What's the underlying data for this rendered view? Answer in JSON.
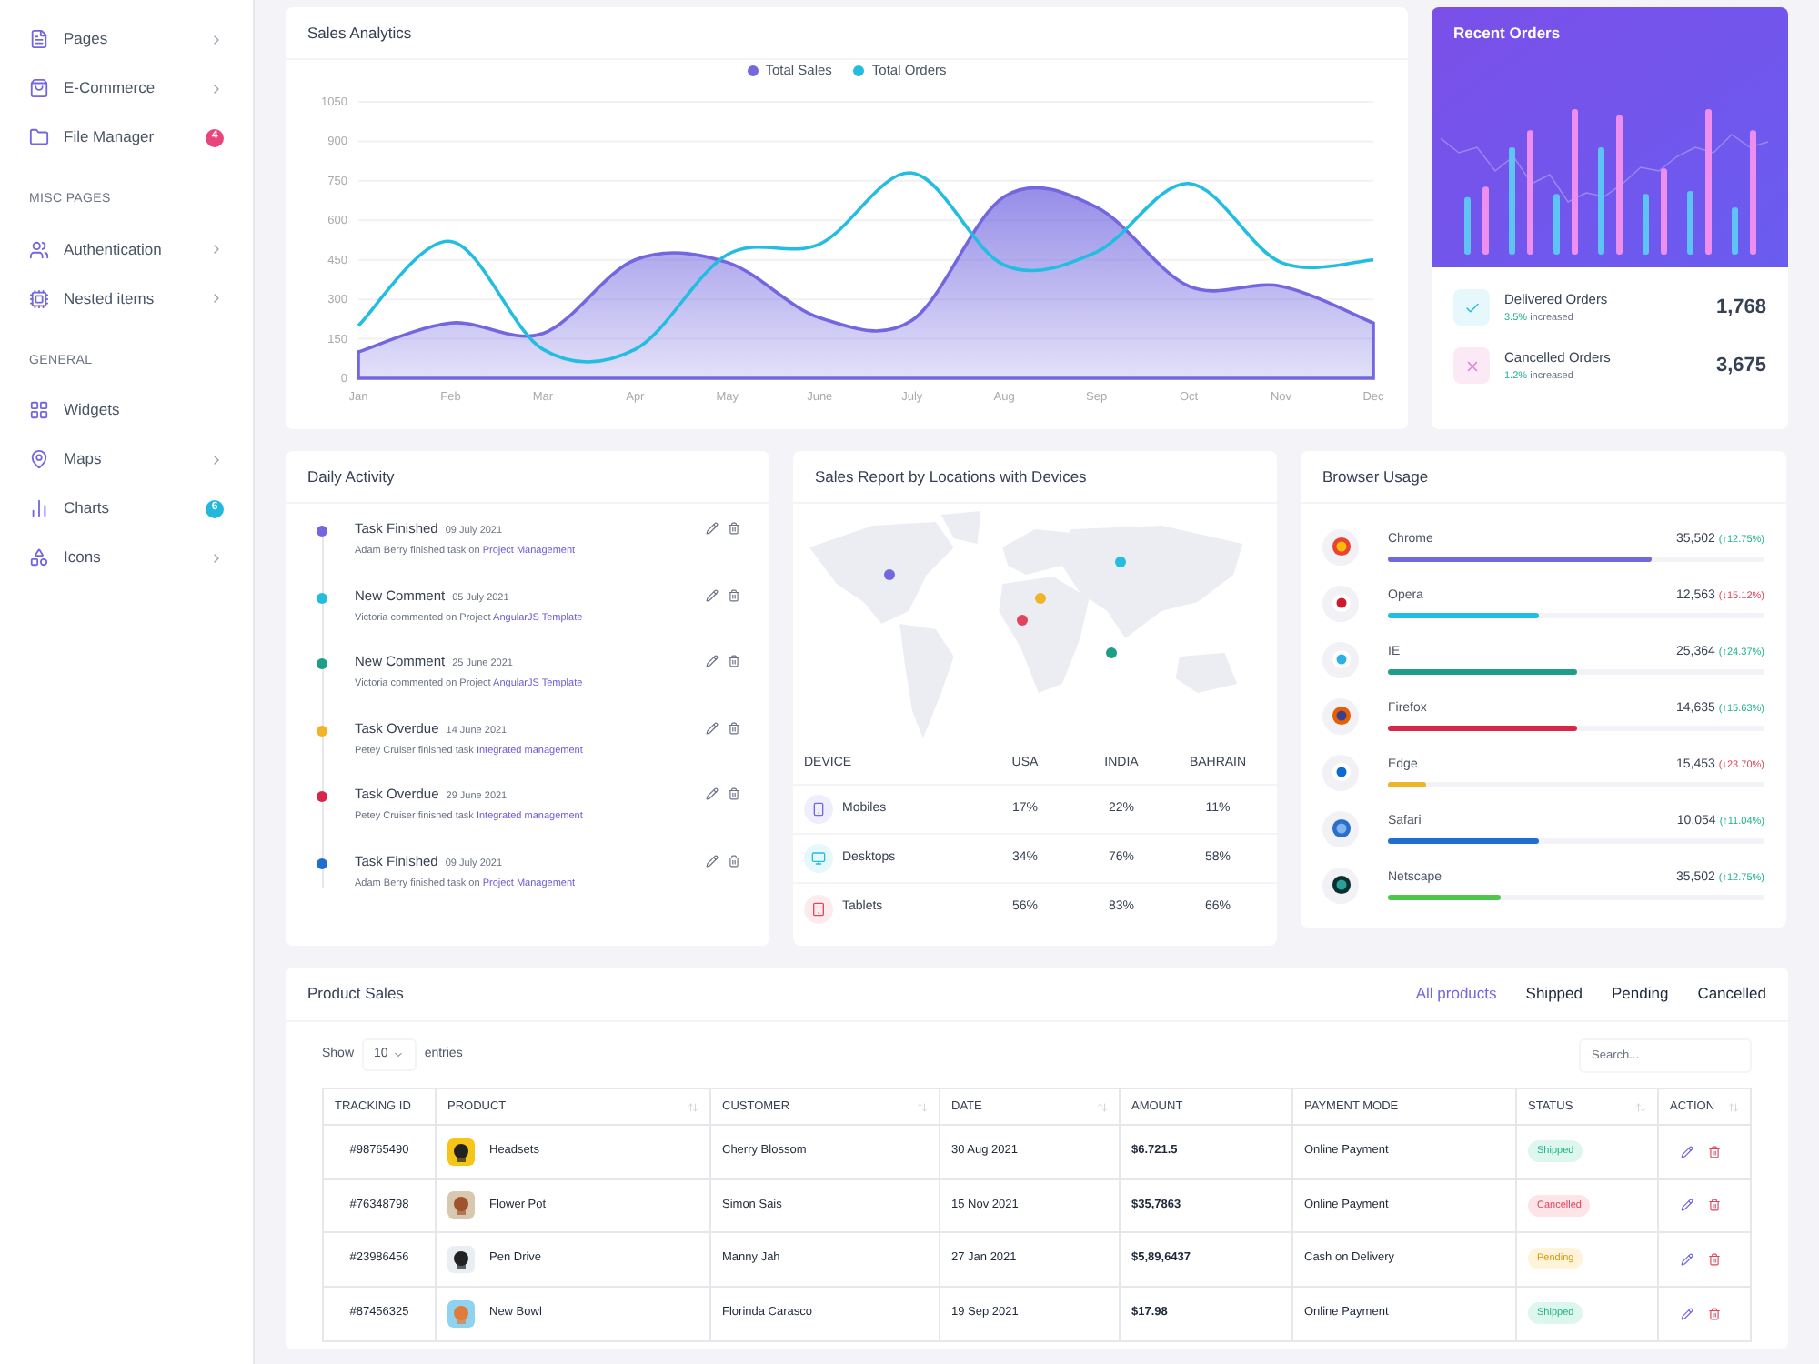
{
  "sidebar": {
    "items": [
      {
        "label": "Pages",
        "chevron": true
      },
      {
        "label": "E-Commerce",
        "chevron": true
      },
      {
        "label": "File Manager",
        "badge": "4",
        "color": "#e8457c"
      },
      {
        "section": "MISC PAGES"
      },
      {
        "label": "Authentication",
        "chevron": true
      },
      {
        "label": "Nested items",
        "chevron": true
      },
      {
        "section": "GENERAL"
      },
      {
        "label": "Widgets"
      },
      {
        "label": "Maps",
        "chevron": true
      },
      {
        "label": "Charts",
        "badge": "6",
        "color": "#22b8dc"
      },
      {
        "label": "Icons",
        "chevron": true
      }
    ]
  },
  "sales_analytics": {
    "title": "Sales Analytics",
    "chart_data": {
      "type": "area",
      "categories": [
        "Jan",
        "Feb",
        "Mar",
        "Apr",
        "May",
        "June",
        "July",
        "Aug",
        "Sep",
        "Oct",
        "Nov",
        "Dec"
      ],
      "ylim": [
        0,
        1050
      ],
      "grid": true,
      "yticks": [
        0,
        150,
        300,
        450,
        600,
        750,
        900,
        1050
      ],
      "series": [
        {
          "name": "Total Sales",
          "type": "area",
          "color": "#7367e0",
          "values": [
            100,
            210,
            170,
            450,
            440,
            230,
            220,
            690,
            650,
            350,
            350,
            210
          ]
        },
        {
          "name": "Total Orders",
          "type": "line",
          "color": "#22bde0",
          "values": [
            200,
            520,
            110,
            110,
            470,
            510,
            780,
            430,
            480,
            740,
            440,
            450
          ]
        }
      ]
    }
  },
  "recent_orders": {
    "title": "Recent Orders",
    "stats": [
      {
        "kind": "delivered",
        "label": "Delivered Orders",
        "change": "3.5%",
        "note": "increased",
        "value": "1,768"
      },
      {
        "kind": "cancelled",
        "label": "Cancelled Orders",
        "change": "1.2%",
        "note": "increased",
        "value": "3,675"
      }
    ]
  },
  "daily_activity": {
    "title": "Daily Activity",
    "items": [
      {
        "color": "#7367e0",
        "title": "Task Finished",
        "date": "09 July 2021",
        "text": "Adam Berry finished task on",
        "link": "Project Management"
      },
      {
        "color": "#22bde0",
        "title": "New Comment",
        "date": "05 July 2021",
        "text": "Victoria commented on Project",
        "link": "AngularJS Template"
      },
      {
        "color": "#1e9e86",
        "title": "New Comment",
        "date": "25 June 2021",
        "text": "Victoria commented on Project",
        "link": "AngularJS Template"
      },
      {
        "color": "#f0b429",
        "title": "Task Overdue",
        "date": "14 June 2021",
        "text": "Petey Cruiser finished task",
        "link": "Integrated management"
      },
      {
        "color": "#d6264a",
        "title": "Task Overdue",
        "date": "29 June 2021",
        "text": "Petey Cruiser finished task",
        "link": "Integrated management"
      },
      {
        "color": "#1f6fd1",
        "title": "Task Finished",
        "date": "09 July 2021",
        "text": "Adam Berry finished task on",
        "link": "Project Management"
      }
    ]
  },
  "sales_report": {
    "title": "Sales Report by Locations with Devices",
    "markers": [
      {
        "color": "#7367e0"
      },
      {
        "color": "#f0b429"
      },
      {
        "color": "#e0455a"
      },
      {
        "color": "#22bde0"
      },
      {
        "color": "#1e9e86"
      }
    ],
    "columns": [
      "DEVICE",
      "USA",
      "INDIA",
      "BAHRAIN"
    ],
    "rows": [
      {
        "kind": "mobile",
        "device": "Mobiles",
        "values": [
          "17%",
          "22%",
          "11%"
        ]
      },
      {
        "kind": "desktop",
        "device": "Desktops",
        "values": [
          "34%",
          "76%",
          "58%"
        ]
      },
      {
        "kind": "tablet",
        "device": "Tablets",
        "values": [
          "56%",
          "83%",
          "66%"
        ]
      }
    ]
  },
  "browser_usage": {
    "title": "Browser Usage",
    "items": [
      {
        "name": "Chrome",
        "value": "35,502",
        "change": "(↑12.75%)",
        "rising": true,
        "level": 0.7,
        "color": "#7367e0"
      },
      {
        "name": "Opera",
        "value": "12,563",
        "change": "(↓15.12%)",
        "rising": false,
        "level": 0.4,
        "color": "#22bde0"
      },
      {
        "name": "IE",
        "value": "25,364",
        "change": "(↑24.37%)",
        "rising": true,
        "level": 0.5,
        "color": "#1e9e86"
      },
      {
        "name": "Firefox",
        "value": "14,635",
        "change": "(↑15.63%)",
        "rising": true,
        "level": 0.5,
        "color": "#d6264a"
      },
      {
        "name": "Edge",
        "value": "15,453",
        "change": "(↓23.70%)",
        "rising": false,
        "level": 0.1,
        "color": "#f0b429"
      },
      {
        "name": "Safari",
        "value": "10,054",
        "change": "(↑11.04%)",
        "rising": true,
        "level": 0.4,
        "color": "#1f6fd1"
      },
      {
        "name": "Netscape",
        "value": "35,502",
        "change": "(↑12.75%)",
        "rising": true,
        "level": 0.3,
        "color": "#4cc74c"
      }
    ]
  },
  "product_sales": {
    "title": "Product Sales",
    "tabs": [
      {
        "label": "All products",
        "selected": true
      },
      {
        "label": "Shipped",
        "selected": false
      },
      {
        "label": "Pending",
        "selected": false
      },
      {
        "label": "Cancelled",
        "selected": false
      }
    ],
    "show_label": "Show",
    "page_size": "10",
    "entries_label": "entries",
    "search": {
      "placeholder": "Search..."
    },
    "columns": [
      {
        "label": "TRACKING ID",
        "sortable": false
      },
      {
        "label": "PRODUCT",
        "sortable": true
      },
      {
        "label": "CUSTOMER",
        "sortable": true
      },
      {
        "label": "DATE",
        "sortable": true
      },
      {
        "label": "AMOUNT",
        "sortable": false
      },
      {
        "label": "PAYMENT MODE",
        "sortable": false
      },
      {
        "label": "STATUS",
        "sortable": true
      },
      {
        "label": "ACTION",
        "sortable": true
      }
    ],
    "rows": [
      {
        "id": "#98765490",
        "product": "Headsets",
        "customer": "Cherry Blossom",
        "date": "30 Aug 2021",
        "amount": "$6.721.5",
        "payment": "Online Payment",
        "status": "Shipped",
        "kind": "shipped"
      },
      {
        "id": "#76348798",
        "product": "Flower Pot",
        "customer": "Simon Sais",
        "date": "15 Nov 2021",
        "amount": "$35,7863",
        "payment": "Online Payment",
        "status": "Cancelled",
        "kind": "cancelled"
      },
      {
        "id": "#23986456",
        "product": "Pen Drive",
        "customer": "Manny Jah",
        "date": "27 Jan 2021",
        "amount": "$5,89,6437",
        "payment": "Cash on Delivery",
        "status": "Pending",
        "kind": "pending"
      },
      {
        "id": "#87456325",
        "product": "New Bowl",
        "customer": "Florinda Carasco",
        "date": "19 Sep 2021",
        "amount": "$17.98",
        "payment": "Online Payment",
        "status": "Shipped",
        "kind": "shipped"
      }
    ]
  }
}
